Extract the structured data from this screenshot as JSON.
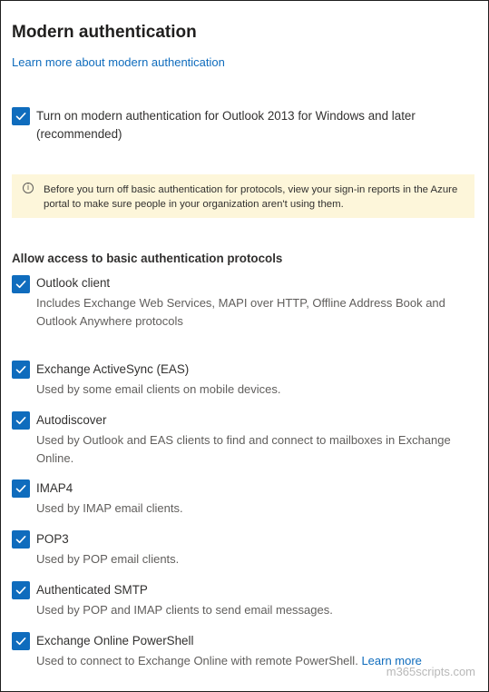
{
  "page": {
    "title": "Modern authentication",
    "learn_more_link": "Learn more about modern authentication"
  },
  "modern_auth": {
    "label": "Turn on modern authentication for Outlook 2013 for Windows and later (recommended)",
    "checked": true
  },
  "warning": {
    "icon": "info-icon",
    "text": "Before you turn off basic authentication for protocols, view your sign-in reports in the Azure portal to make sure people in your organization aren't using them."
  },
  "protocols_section": {
    "heading": "Allow access to basic authentication protocols",
    "items": [
      {
        "label": "Outlook client",
        "description": "Includes Exchange Web Services, MAPI over HTTP, Offline Address Book and Outlook Anywhere protocols",
        "checked": true
      },
      {
        "label": "Exchange ActiveSync (EAS)",
        "description": "Used by some email clients on mobile devices.",
        "checked": true
      },
      {
        "label": "Autodiscover",
        "description": "Used by Outlook and EAS clients to find and connect to mailboxes in Exchange Online.",
        "checked": true
      },
      {
        "label": "IMAP4",
        "description": "Used by IMAP email clients.",
        "checked": true
      },
      {
        "label": "POP3",
        "description": "Used by POP email clients.",
        "checked": true
      },
      {
        "label": "Authenticated SMTP",
        "description": "Used by POP and IMAP clients to send email messages.",
        "checked": true
      },
      {
        "label": "Exchange Online PowerShell",
        "description": "Used to connect to Exchange Online with remote PowerShell.",
        "link": "Learn more",
        "checked": true
      }
    ]
  },
  "watermark": "m365scripts.com",
  "colors": {
    "accent": "#0f6cbd",
    "warning_background": "#fdf6da",
    "text": "#323130",
    "secondary_text": "#605e5c"
  }
}
